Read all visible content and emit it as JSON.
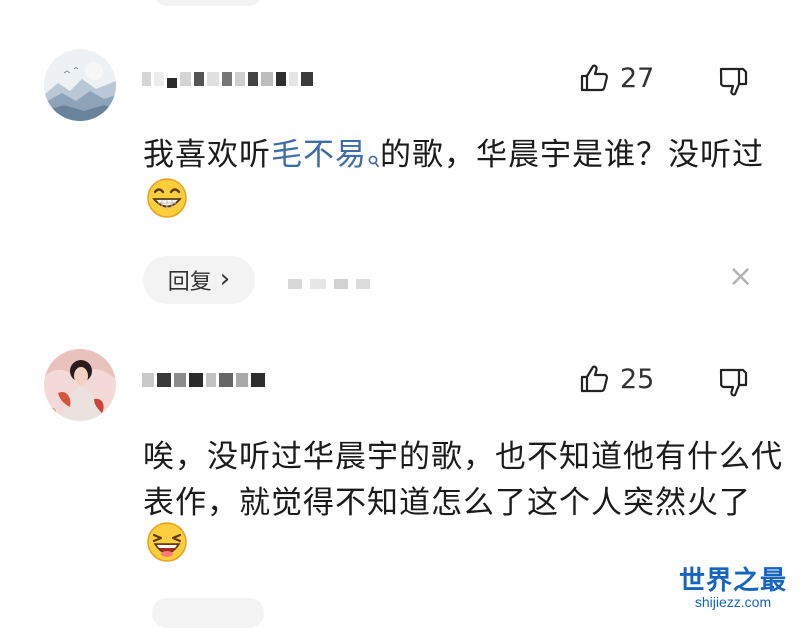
{
  "comments": [
    {
      "likes": "27",
      "text_before_link": "我喜欢听",
      "link": "毛不易",
      "text_after_link": "的歌，华晨宇是谁？没听过",
      "emoji": "grin-emoji",
      "reply_label": "回复",
      "reply_arrow": "›",
      "close": "×"
    },
    {
      "likes": "25",
      "text": "唉，没听过华晨宇的歌，也不知道他有什么代表作，就觉得不知道怎么了这个人突然火了",
      "emoji": "laugh-emoji"
    }
  ],
  "watermark": {
    "main": "世界之最",
    "sub": "shijiezz.com"
  },
  "colors": {
    "link": "#3d6ca6",
    "watermark": "#1564c0",
    "pill": "#f3f3f3"
  }
}
